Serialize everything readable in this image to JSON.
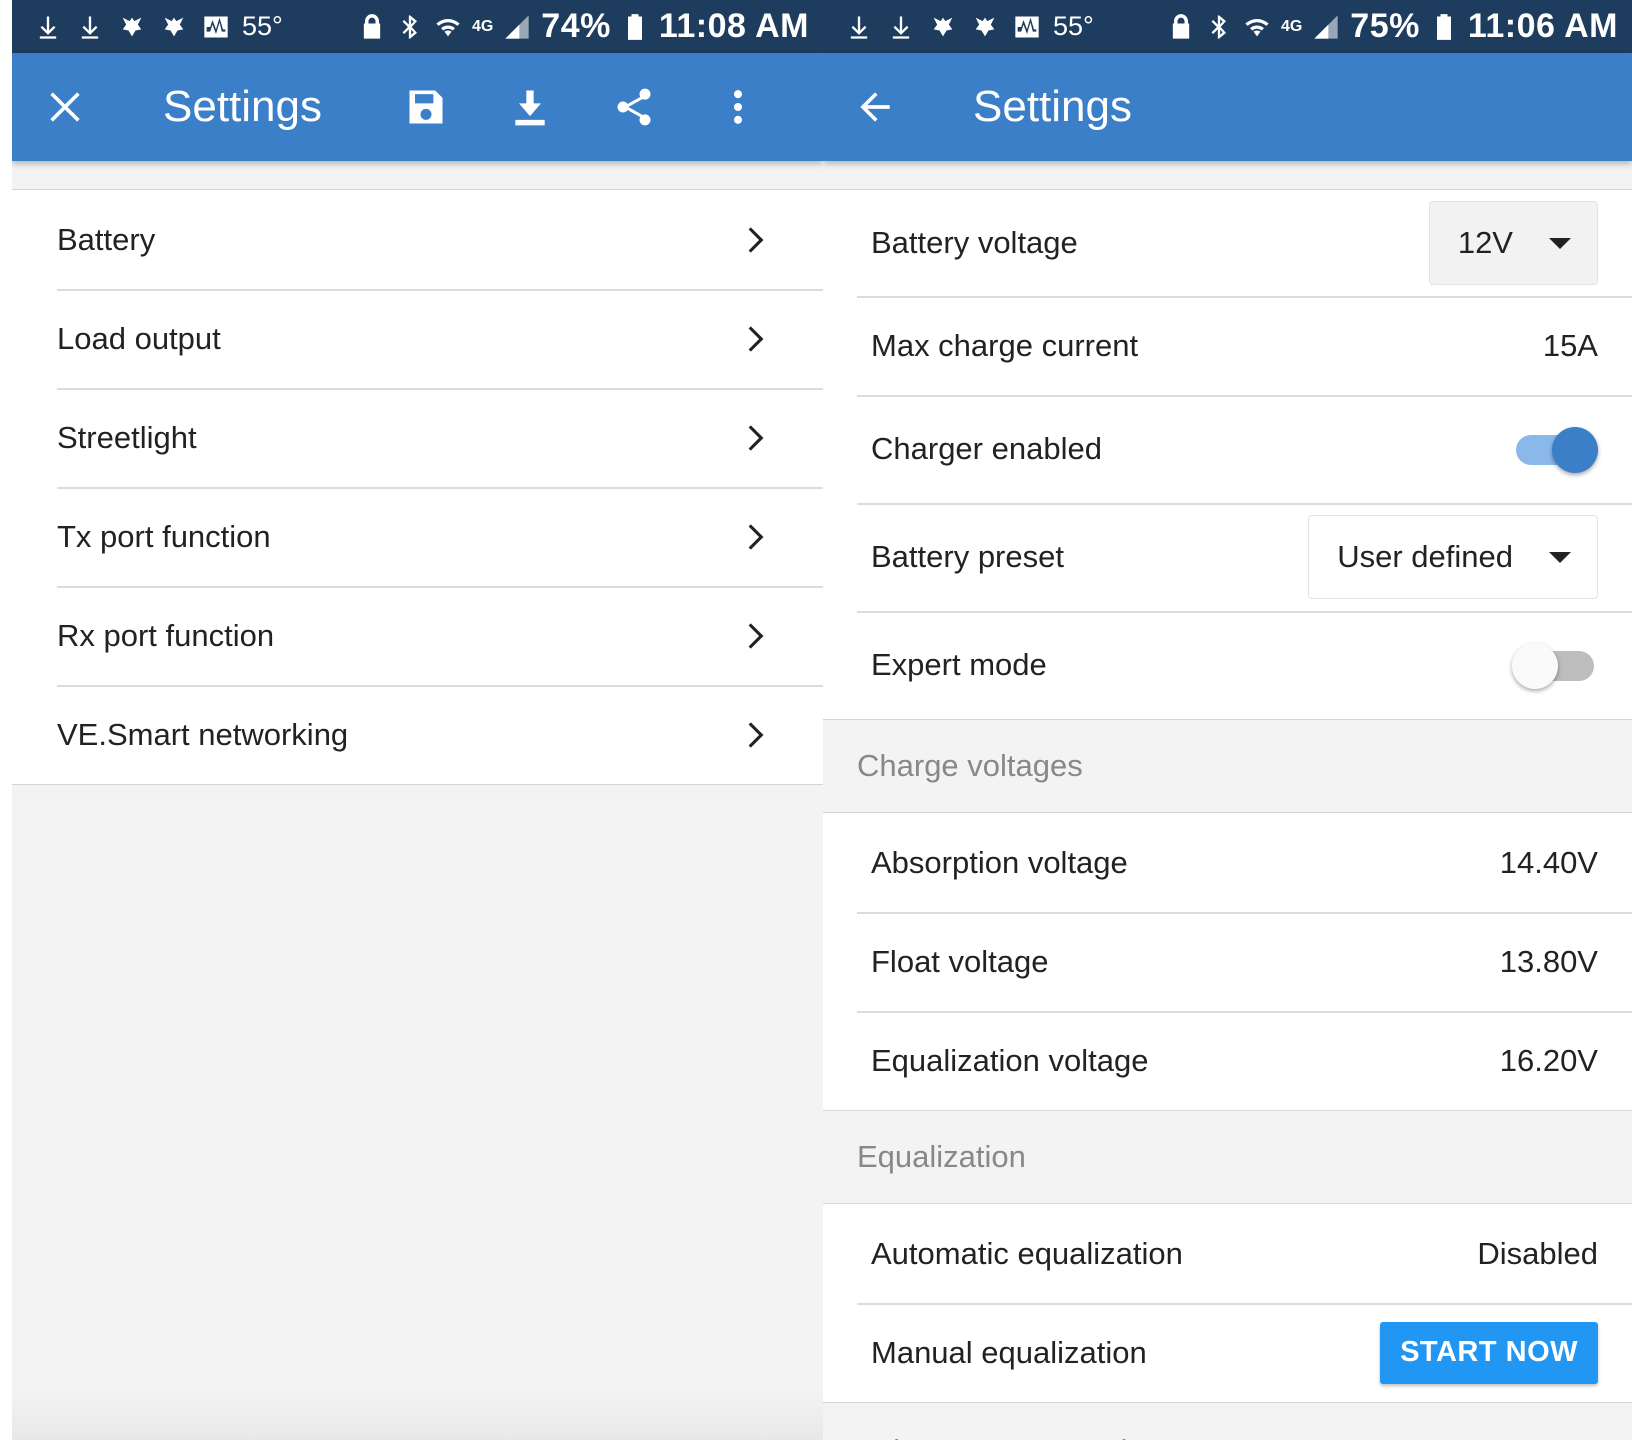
{
  "left": {
    "status": {
      "temperature": "55°",
      "network": "4G",
      "battery_percent": "74%",
      "time": "11:08 AM"
    },
    "appbar": {
      "title": "Settings",
      "icons": [
        "close-icon",
        "save-icon",
        "download-icon",
        "share-icon",
        "more-vert-icon"
      ]
    },
    "menu": [
      {
        "label": "Battery"
      },
      {
        "label": "Load output"
      },
      {
        "label": "Streetlight"
      },
      {
        "label": "Tx port function"
      },
      {
        "label": "Rx port function"
      },
      {
        "label": "VE.Smart networking"
      }
    ]
  },
  "right": {
    "status": {
      "temperature": "55°",
      "network": "4G",
      "battery_percent": "75%",
      "time": "11:06 AM"
    },
    "appbar": {
      "title": "Settings",
      "icons": [
        "back-arrow-icon"
      ]
    },
    "battery": {
      "voltage_label": "Battery voltage",
      "voltage_value": "12V",
      "max_current_label": "Max charge current",
      "max_current_value": "15A",
      "charger_label": "Charger enabled",
      "charger_on": true,
      "preset_label": "Battery preset",
      "preset_value": "User defined",
      "expert_label": "Expert mode",
      "expert_on": false
    },
    "charge_voltages": {
      "header": "Charge voltages",
      "absorption_label": "Absorption voltage",
      "absorption_value": "14.40V",
      "float_label": "Float voltage",
      "float_value": "13.80V",
      "equalization_label": "Equalization voltage",
      "equalization_value": "16.20V"
    },
    "equalization": {
      "header": "Equalization",
      "auto_label": "Automatic equalization",
      "auto_value": "Disabled",
      "manual_label": "Manual equalization",
      "manual_button": "START NOW"
    },
    "next_section_header": "Voltage compensation"
  },
  "colors": {
    "statusbar": "#1e3c5e",
    "appbar": "#3b7fc8",
    "toggle_on": "#3b7fc8",
    "button": "#2196f3"
  }
}
